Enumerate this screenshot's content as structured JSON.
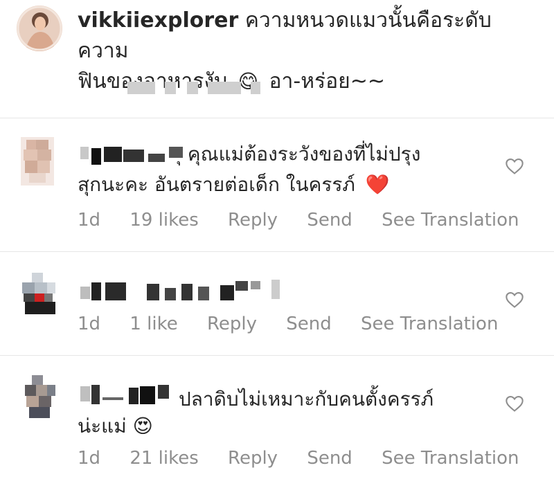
{
  "caption": {
    "username": "vikkiiexplorer",
    "text_line1": "ความหนวดแมวนั้นคือระดับความ",
    "text_line2_a": "ฟินของอาหารงับ",
    "emoji_1": "😋",
    "text_line2_b": "อา-หร่อย~~"
  },
  "comments": [
    {
      "text_line1": "ุ คุณแม่ต้องระวังของที่ไม่ปรุง",
      "text_line2": "สุกนะคะ อันตรายต่อเด็ก ในครรภ์",
      "emoji": "❤️",
      "meta": {
        "time": "1d",
        "likes": "19 likes",
        "reply": "Reply",
        "send": "Send",
        "translate": "See Translation"
      }
    },
    {
      "meta": {
        "time": "1d",
        "likes": "1 like",
        "reply": "Reply",
        "send": "Send",
        "translate": "See Translation"
      }
    },
    {
      "text_line1": "ปลาดิบไม่เหมาะกับคนตั้งครรภ์",
      "text_line2": "น่ะแม่",
      "emoji": "😍",
      "meta": {
        "time": "1d",
        "likes": "21 likes",
        "reply": "Reply",
        "send": "Send",
        "translate": "See Translation"
      }
    }
  ],
  "icons": {
    "like": "heart-outline-icon"
  },
  "colors": {
    "meta_text": "#8e8e8e",
    "text": "#262626",
    "divider": "#e6e6e6"
  }
}
